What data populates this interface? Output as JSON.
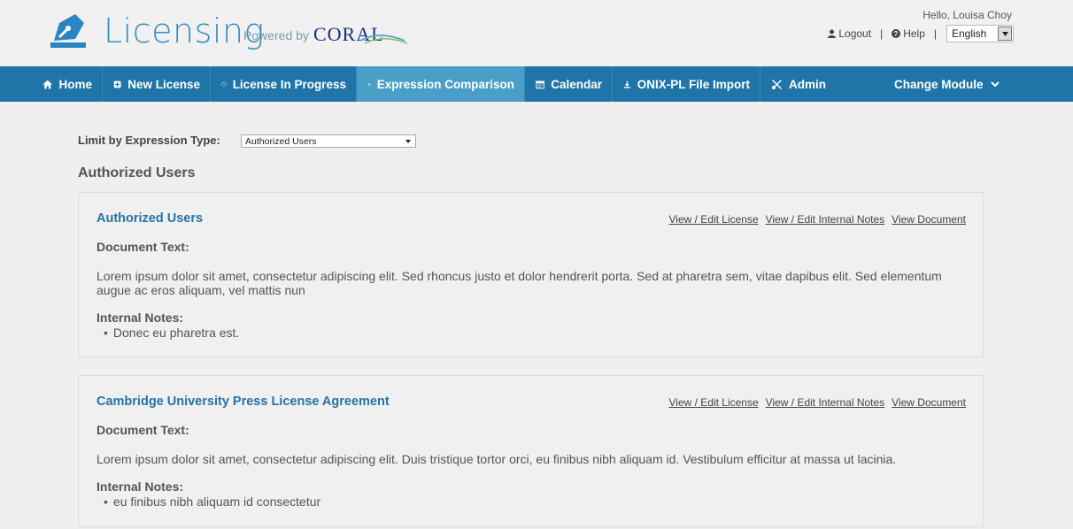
{
  "header": {
    "app_title": "Licensing",
    "powered_by": "Powered by",
    "coral_logo_text": "CORAL",
    "greeting": "Hello, Louisa Choy",
    "logout_label": "Logout",
    "help_label": "Help",
    "language_value": "English"
  },
  "nav": {
    "items": [
      {
        "label": "Home",
        "icon": "home-icon"
      },
      {
        "label": "New License",
        "icon": "plus-square-icon"
      },
      {
        "label": "License In Progress",
        "icon": "spinner-icon"
      },
      {
        "label": "Expression Comparison",
        "icon": "balance-icon"
      },
      {
        "label": "Calendar",
        "icon": "calendar-icon"
      },
      {
        "label": "ONIX-PL File Import",
        "icon": "download-icon"
      },
      {
        "label": "Admin",
        "icon": "tools-icon"
      }
    ],
    "active_index": 3,
    "change_module_label": "Change Module"
  },
  "filter": {
    "label": "Limit by Expression Type:",
    "selected": "Authorized Users"
  },
  "section_title": "Authorized Users",
  "cards": [
    {
      "title": "Authorized Users",
      "links": [
        "View / Edit License",
        "View / Edit Internal Notes",
        "View Document"
      ],
      "doc_label": "Document Text:",
      "doc_text": "Lorem ipsum dolor sit amet, consectetur adipiscing elit. Sed rhoncus justo et dolor hendrerit porta. Sed at pharetra sem, vitae dapibus elit. Sed elementum augue ac eros aliquam, vel mattis nun",
      "notes_label": "Internal Notes:",
      "notes": [
        "Donec eu pharetra est."
      ]
    },
    {
      "title": "Cambridge University Press License Agreement",
      "links": [
        "View / Edit License",
        "View / Edit Internal Notes",
        "View Document"
      ],
      "doc_label": "Document Text:",
      "doc_text": "Lorem ipsum dolor sit amet, consectetur adipiscing elit. Duis tristique tortor orci, eu finibus nibh aliquam id. Vestibulum efficitur at massa ut lacinia.",
      "notes_label": "Internal Notes:",
      "notes": [
        "eu finibus nibh aliquam id consectetur"
      ]
    }
  ],
  "colors": {
    "nav_bg": "#1f75a8",
    "nav_active": "#4a9fc9",
    "link_blue": "#2374a8",
    "page_bg": "#efefef"
  }
}
